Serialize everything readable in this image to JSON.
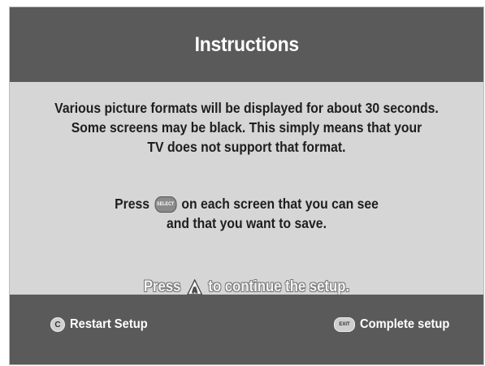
{
  "header": {
    "title": "Instructions"
  },
  "content": {
    "line1": "Various picture formats will be displayed for about 30 seconds.",
    "line2": "Some screens may be black.  This simply means that your",
    "line3": "TV does not support that format.",
    "press_prefix": "Press",
    "select_icon_label": "SELECT",
    "press_suffix": "on each screen that you can see",
    "line5": "and that you want to save.",
    "continue_prefix": "Press",
    "a_icon_label": "A",
    "continue_suffix": "to continue the setup."
  },
  "footer": {
    "left": {
      "icon_label": "C",
      "label": "Restart Setup"
    },
    "right": {
      "icon_label": "EXIT",
      "label": "Complete setup"
    }
  },
  "icons": {
    "select": "select-button-icon",
    "a": "a-triangle-icon",
    "c": "c-button-icon",
    "exit": "exit-button-icon"
  }
}
